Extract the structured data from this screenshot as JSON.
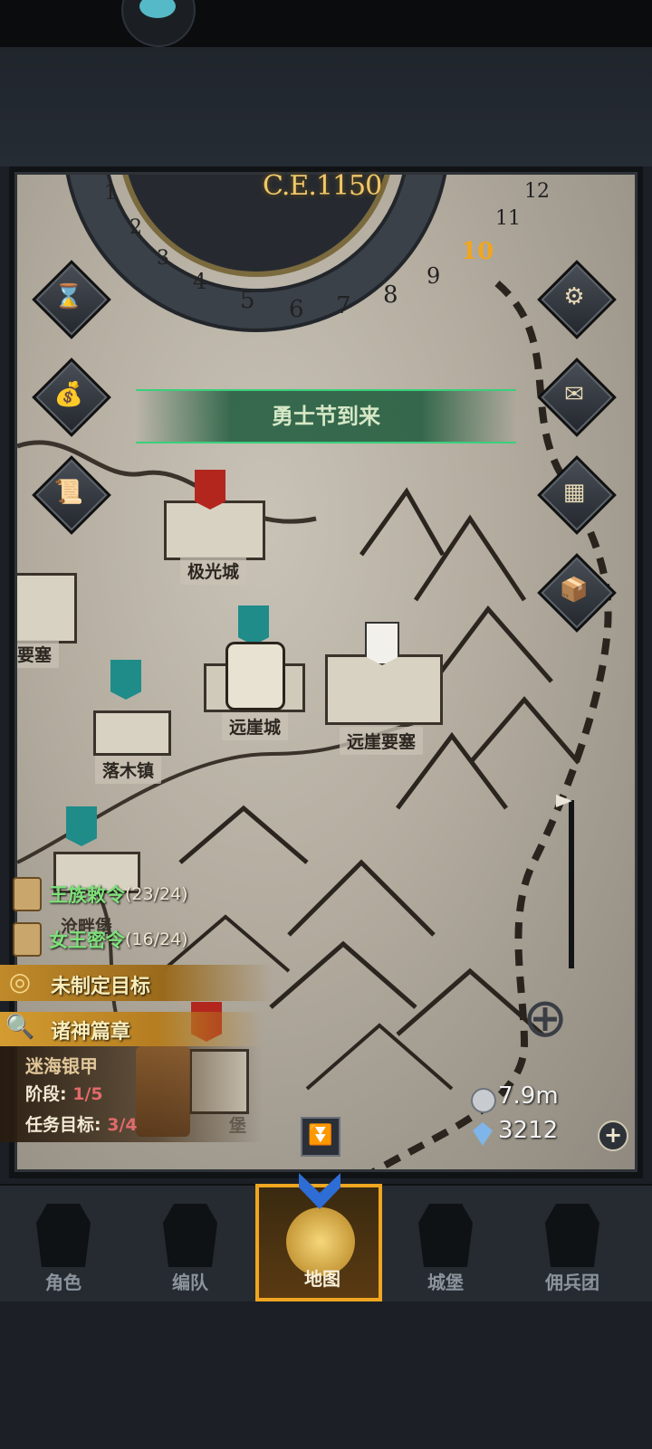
{
  "calendar": {
    "year": "C.E.1150",
    "months": [
      "1",
      "2",
      "3",
      "4",
      "5",
      "6",
      "7",
      "8",
      "9",
      "10",
      "11",
      "12"
    ],
    "current_month": "10"
  },
  "event_banner": "勇士节到来",
  "map_nodes": {
    "aurora_city": "极光城",
    "left_fortress_partial": "要塞",
    "farcliff_city": "远崖城",
    "farcliff_fortress": "远崖要塞",
    "fallwood_town": "落木镇",
    "hidden_castle_partial": "沧畔堡",
    "lower_castle_partial": "堡"
  },
  "orders": [
    {
      "name": "王族敕令",
      "count": "(23/24)"
    },
    {
      "name": "女王密令",
      "count": "(16/24)"
    }
  ],
  "goal": "未制定目标",
  "chapter": {
    "title": "诸神篇章",
    "quest_name": "迷海银甲",
    "stage_label": "阶段: ",
    "stage_value": "1/5",
    "task_label": "任务目标: ",
    "task_value": "3/4"
  },
  "resources": {
    "silver": "7.9m",
    "gems": "3212"
  },
  "nav": {
    "items": [
      {
        "label": "角色"
      },
      {
        "label": "编队"
      },
      {
        "label": "地图"
      },
      {
        "label": "城堡"
      },
      {
        "label": "佣兵团"
      }
    ],
    "active": "地图"
  },
  "colors": {
    "accent": "#f0a620",
    "order_green": "#7ee07a",
    "banner_green": "#39d07a",
    "year_gold": "#f0c76a"
  }
}
